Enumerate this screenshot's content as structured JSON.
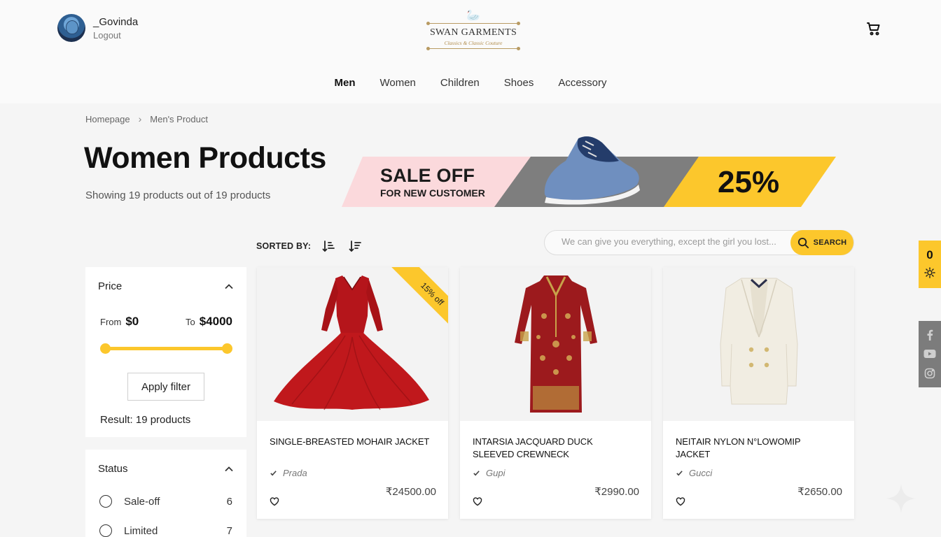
{
  "header": {
    "user_name": "_Govinda",
    "logout_label": "Logout",
    "brand_name": "SWAN GARMENTS",
    "brand_tagline": "Classics & Classic Couture"
  },
  "nav": [
    {
      "label": "Men",
      "active": true
    },
    {
      "label": "Women",
      "active": false
    },
    {
      "label": "Children",
      "active": false
    },
    {
      "label": "Shoes",
      "active": false
    },
    {
      "label": "Accessory",
      "active": false
    }
  ],
  "breadcrumb": [
    "Homepage",
    "Men's Product"
  ],
  "page": {
    "title": "Women Products",
    "showing": "Showing 19 products out of 19 products"
  },
  "banner": {
    "line1": "SALE OFF",
    "line2": "FOR NEW CUSTOMER",
    "discount": "25%"
  },
  "toolbar": {
    "sorted_label": "SORTED BY:",
    "search_placeholder": "We can give you everything, except the girl you lost...",
    "search_button": "SEARCH"
  },
  "filters": {
    "price": {
      "title": "Price",
      "from_label": "From",
      "from_value": "$0",
      "to_label": "To",
      "to_value": "$4000",
      "range_min_fraction": 0,
      "range_max_fraction": 1,
      "apply_label": "Apply filter",
      "result": "Result: 19 products"
    },
    "status": {
      "title": "Status",
      "options": [
        {
          "label": "Sale-off",
          "count": "6"
        },
        {
          "label": "Limited",
          "count": "7"
        }
      ]
    }
  },
  "products": [
    {
      "title": "SINGLE-BREASTED MOHAIR JACKET",
      "brand": "Prada",
      "price": "₹24500.00",
      "badge": "15% off"
    },
    {
      "title": "INTARSIA JACQUARD DUCK SLEEVED CREWNECK",
      "brand": "Gupi",
      "price": "₹2990.00",
      "badge": ""
    },
    {
      "title": "NEIтAIR NYLON N°LOWOMIP JACKET",
      "brand": "Gucci",
      "price": "₹2650.00",
      "badge": ""
    }
  ],
  "widgets": {
    "theme_count": "0"
  },
  "colors": {
    "accent": "#fcc72c",
    "sale_pink": "#fbd9dc",
    "sale_gray": "#7e7e7e",
    "dress_red": "#c0181c",
    "social_gray": "#7c7c7c"
  }
}
